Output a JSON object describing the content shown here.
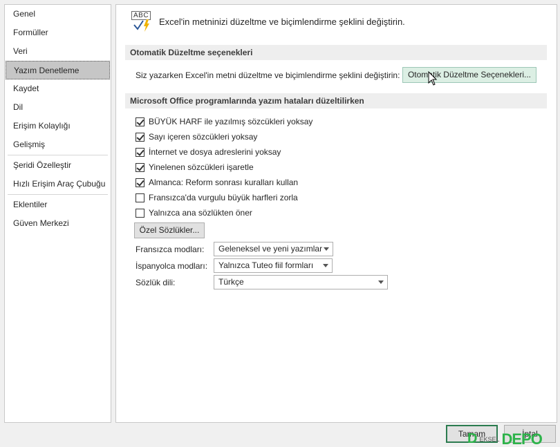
{
  "sidebar": {
    "items": [
      {
        "label": "Genel"
      },
      {
        "label": "Formüller"
      },
      {
        "label": "Veri"
      },
      {
        "label": "Yazım Denetleme"
      },
      {
        "label": "Kaydet"
      },
      {
        "label": "Dil"
      },
      {
        "label": "Erişim Kolaylığı"
      },
      {
        "label": "Gelişmiş"
      },
      {
        "label": "Şeridi Özelleştir"
      },
      {
        "label": "Hızlı Erişim Araç Çubuğu"
      },
      {
        "label": "Eklentiler"
      },
      {
        "label": "Güven Merkezi"
      }
    ],
    "selected": "Yazım Denetleme"
  },
  "header": {
    "icon": "abc-check-icon",
    "icon_text": "ABC",
    "text": "Excel'in metninizi düzeltme ve biçimlendirme şeklini değiştirin."
  },
  "autocorrect": {
    "section_title": "Otomatik Düzeltme seçenekleri",
    "description": "Siz yazarken Excel'in metni düzeltme ve biçimlendirme şeklini değiştirin:",
    "button_label": "Otomatik Düzeltme Seçenekleri..."
  },
  "spelling": {
    "section_title": "Microsoft Office programlarında yazım hataları düzeltilirken",
    "options": [
      {
        "label": "BÜYÜK HARF ile yazılmış sözcükleri yoksay",
        "checked": true
      },
      {
        "label": "Sayı içeren sözcükleri yoksay",
        "checked": true
      },
      {
        "label": "İnternet ve dosya adreslerini yoksay",
        "checked": true
      },
      {
        "label": "Yinelenen sözcükleri işaretle",
        "checked": true
      },
      {
        "label": "Almanca: Reform sonrası kuralları kullan",
        "checked": true
      },
      {
        "label": "Fransızca'da vurgulu büyük harfleri zorla",
        "checked": false
      },
      {
        "label": "Yalnızca ana sözlükten öner",
        "checked": false
      }
    ],
    "custom_dict_button": "Özel Sözlükler...",
    "french_label": "Fransızca modları:",
    "french_value": "Geleneksel ve yeni yazımlar",
    "spanish_label": "İspanyolca modları:",
    "spanish_value": "Yalnızca Tuteo fiil formları",
    "dict_lang_label": "Sözlük dili:",
    "dict_lang_value": "Türkçe"
  },
  "footer": {
    "ok_label": "Tamam",
    "cancel_label": "İptal"
  },
  "watermark": {
    "small": "EKSEL",
    "big": "DEPO"
  },
  "colors": {
    "selected_bg": "#c6c6c6",
    "section_bg": "#eeeeee",
    "accent_green": "#2db34a"
  }
}
